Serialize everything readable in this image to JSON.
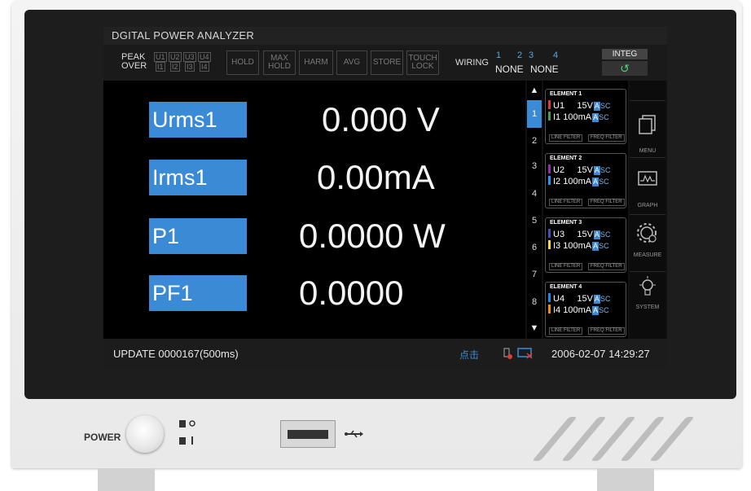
{
  "screen": {
    "title": "DGITAL POWER ANALYZER",
    "toolbar": {
      "peak_label": "PEAK",
      "over_label": "OVER",
      "peak_channels": [
        "U1",
        "U2",
        "U3",
        "U4"
      ],
      "over_channels": [
        "I1",
        "I2",
        "I3",
        "I4"
      ],
      "buttons": [
        "HOLD",
        "MAX HOLD",
        "HARM",
        "AVG",
        "STORE",
        "TOUCH LOCK"
      ],
      "wiring_label": "WIRING",
      "wiring_numbers": [
        "1",
        "2",
        "3",
        "4"
      ],
      "wiring_values": [
        "NONE",
        "NONE"
      ],
      "integ_label": "INTEG",
      "integ_icon": "↺"
    },
    "measurements": [
      {
        "label": "Urms1",
        "value": "0.000 V"
      },
      {
        "label": "Irms1",
        "value": "0.00mA"
      },
      {
        "label": "P1",
        "value": "0.0000 W"
      },
      {
        "label": "PF1",
        "value": "0.0000"
      }
    ],
    "pager": {
      "up_arrow": "▲",
      "down_arrow": "▼",
      "pages": [
        "1",
        "2",
        "3",
        "4",
        "5",
        "6",
        "7",
        "8"
      ],
      "active_page": "1"
    },
    "elements": [
      {
        "title": "ELEMENT 1",
        "u_label": "U1",
        "u_range": "15V",
        "i_label": "I1",
        "i_range": "100mA",
        "u_color": "#e53935",
        "i_color": "#43a047",
        "a": "A",
        "sc": "SC",
        "filter1": "LINE FILTER",
        "filter2": "FREQ FILTER"
      },
      {
        "title": "ELEMENT 2",
        "u_label": "U2",
        "u_range": "15V",
        "i_label": "I2",
        "i_range": "100mA",
        "u_color": "#9c27b0",
        "i_color": "#2196f3",
        "a": "A",
        "sc": "SC",
        "filter1": "LINE FILTER",
        "filter2": "FREQ FILTER"
      },
      {
        "title": "ELEMENT 3",
        "u_label": "U3",
        "u_range": "15V",
        "i_label": "I3",
        "i_range": "100mA",
        "u_color": "#3f51b5",
        "i_color": "#fdd835",
        "a": "A",
        "sc": "SC",
        "filter1": "LINE FILTER",
        "filter2": "FREQ FILTER"
      },
      {
        "title": "ELEMENT 4",
        "u_label": "U4",
        "u_range": "15V",
        "i_label": "I4",
        "i_range": "100mA",
        "u_color": "#1e88e5",
        "i_color": "#fb8c00",
        "a": "A",
        "sc": "SC",
        "filter1": "LINE FILTER",
        "filter2": "FREQ FILTER"
      }
    ],
    "side_menu": [
      {
        "label": "MENU",
        "icon": "menu-icon"
      },
      {
        "label": "GRAPH",
        "icon": "graph-icon"
      },
      {
        "label": "MEASURE",
        "icon": "gear-icon"
      },
      {
        "label": "SYSTEM",
        "icon": "bulb-icon"
      }
    ],
    "status": {
      "update": "UPDATE 0000167(500ms)",
      "click_hint": "点击",
      "datetime": "2006-02-07 14:29:27"
    }
  },
  "front_panel": {
    "power_label": "POWER"
  },
  "colors": {
    "accent": "#3a8ad6",
    "screen_bg": "#000000",
    "integ_icon": "#4bd17c"
  }
}
